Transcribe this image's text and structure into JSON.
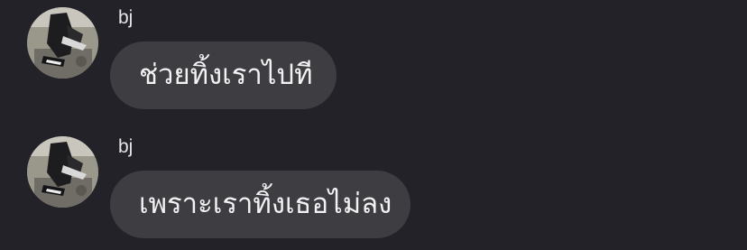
{
  "chat": {
    "messages": [
      {
        "sender": "bj",
        "text": "ช่วยทิ้งเราไปที"
      },
      {
        "sender": "bj",
        "text": "เพราะเราทิ้งเธอไม่ลง"
      }
    ]
  },
  "theme": {
    "background": "#222228",
    "bubble": "#3d3d42",
    "text": "#f2f2f2"
  }
}
